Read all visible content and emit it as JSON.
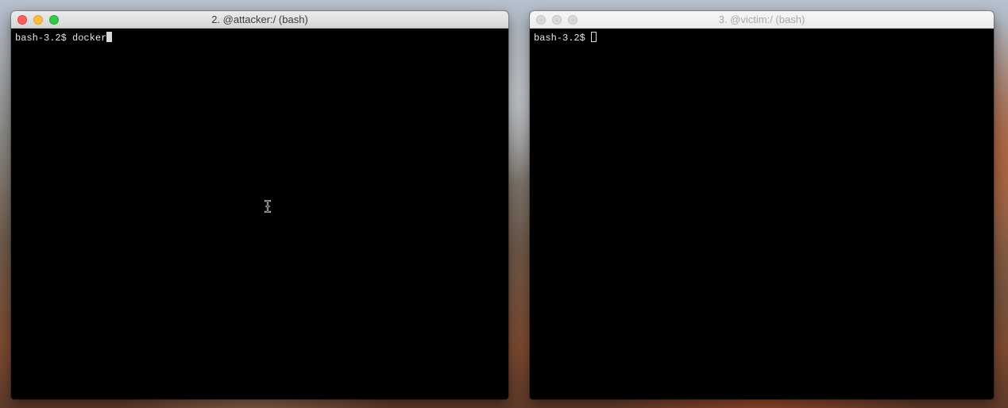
{
  "windows": {
    "attacker": {
      "title": "2. @attacker:/ (bash)",
      "prompt": "bash-3.2$ ",
      "input": "docker",
      "active": true
    },
    "victim": {
      "title": "3. @victim:/ (bash)",
      "prompt": "bash-3.2$ ",
      "input": "",
      "active": false
    }
  },
  "colors": {
    "terminal_bg": "#000000",
    "terminal_fg": "#e6e6e6",
    "close": "#fc605c",
    "minimize": "#fdbc40",
    "zoom": "#34c84a"
  },
  "icons": [
    "close-icon",
    "minimize-icon",
    "zoom-icon",
    "text-cursor-icon"
  ]
}
